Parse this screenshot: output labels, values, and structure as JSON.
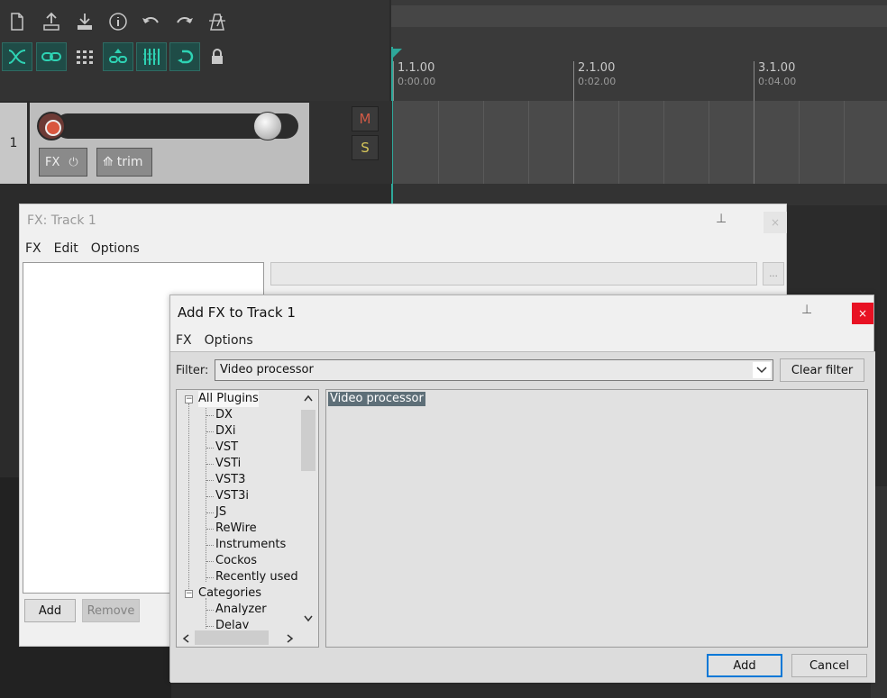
{
  "toolbar": {
    "icons": [
      "new-file-icon",
      "save-icon",
      "open-icon",
      "info-icon",
      "undo-icon",
      "redo-icon",
      "metronome-icon"
    ],
    "toggles": [
      "crossfade-icon",
      "link-icon",
      "grid-icon",
      "ripple-icon",
      "snap-grid-icon",
      "loop-icon",
      "lock-icon"
    ]
  },
  "timeline": {
    "marks": [
      {
        "bar": "1.1.00",
        "time": "0:00.00"
      },
      {
        "bar": "2.1.00",
        "time": "0:02.00"
      },
      {
        "bar": "3.1.00",
        "time": "0:04.00"
      }
    ]
  },
  "track": {
    "number": "1",
    "fx_label": "FX",
    "trim_label": "trim",
    "mute_label": "M",
    "solo_label": "S"
  },
  "fx_window": {
    "title": "FX: Track 1",
    "menu": [
      "FX",
      "Edit",
      "Options"
    ],
    "preset_button": "...",
    "add_label": "Add",
    "remove_label": "Remove",
    "close_label": "×"
  },
  "add_fx": {
    "title": "Add FX to Track 1",
    "close_label": "×",
    "menu": [
      "FX",
      "Options"
    ],
    "filter_label": "Filter:",
    "filter_value": "Video processor",
    "clear_filter_label": "Clear filter",
    "tree": {
      "root": "All Plugins",
      "children": [
        "DX",
        "DXi",
        "VST",
        "VSTi",
        "VST3",
        "VST3i",
        "JS",
        "ReWire",
        "Instruments",
        "Cockos",
        "Recently used"
      ],
      "categories_label": "Categories",
      "category_children": [
        "Analyzer",
        "Delay"
      ]
    },
    "results": [
      "Video processor"
    ],
    "add_label": "Add",
    "cancel_label": "Cancel"
  },
  "colors": {
    "accent_teal": "#2ed3b4",
    "close_red": "#e81123",
    "selection": "#5e6f78"
  }
}
